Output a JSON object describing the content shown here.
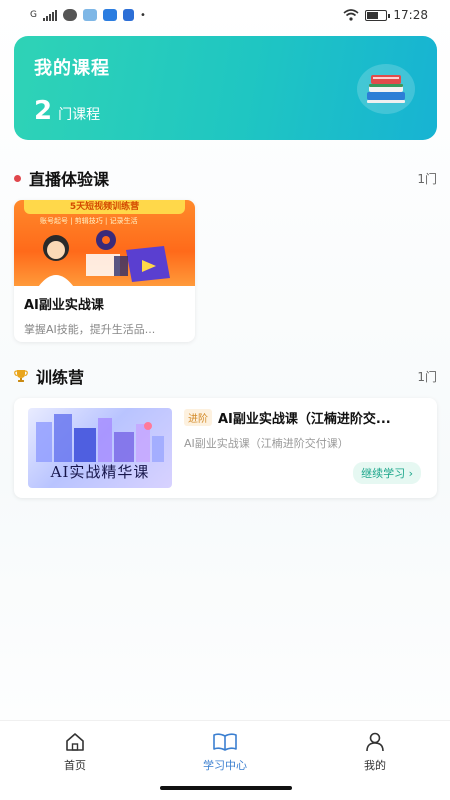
{
  "status": {
    "carrier": "G",
    "time": "17:28"
  },
  "hero": {
    "title": "我的课程",
    "count": "2",
    "unit": "门课程"
  },
  "live": {
    "title": "直播体验课",
    "count": "1门",
    "card": {
      "banner": "5天短视频训练营",
      "tagline": "账号起号 | 剪辑技巧 | 记录生活",
      "title": "AI副业实战课",
      "desc": "掌握AI技能，提升生活品..."
    }
  },
  "camp": {
    "title": "训练营",
    "count": "1门",
    "card": {
      "thumb_text": "AI实战精华课",
      "tag": "进阶",
      "title": "AI副业实战课（江楠进阶交...",
      "subtitle": "AI副业实战课（江楠进阶交付课）",
      "button": "继续学习 ›"
    }
  },
  "tabs": [
    {
      "label": "首页"
    },
    {
      "label": "学习中心"
    },
    {
      "label": "我的"
    }
  ],
  "colors": {
    "accent": "#1fc6c2",
    "active_tab": "#3b7fd0",
    "live_dot": "#e0474c"
  }
}
